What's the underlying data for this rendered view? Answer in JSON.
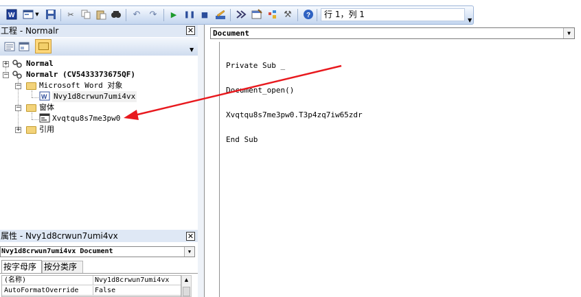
{
  "toolbar": {
    "position_text": "行 1，列 1"
  },
  "project_panel": {
    "title": "工程 - Normalr",
    "close_glyph": "✕",
    "tree": {
      "normal": "Normal",
      "normalr": "Normalr (CV5433373675QF)",
      "word_objects": "Microsoft Word 对象",
      "document": "Nvy1d8crwun7umi4vx",
      "forms": "窗体",
      "form_item": "Xvqtqu8s7me3pw0",
      "references": "引用"
    }
  },
  "properties_panel": {
    "title": "属性 - Nvy1d8crwun7umi4vx",
    "close_glyph": "✕",
    "object_select": "Nvy1d8crwun7umi4vx Document",
    "tabs": [
      "按字母序",
      "按分类序"
    ],
    "rows": [
      {
        "name": "(名称)",
        "value": "Nvy1d8crwun7umi4vx"
      },
      {
        "name": "AutoFormatOverride",
        "value": "False"
      }
    ]
  },
  "code_window": {
    "object_combo": "Document",
    "lines": [
      "Private Sub _",
      "Document_open()",
      "Xvqtqu8s7me3pw0.T3p4zq7iw65zdr",
      "End Sub"
    ]
  },
  "colors": {
    "arrow": "#e8191e",
    "panel_title_bg": "#dfe8f5",
    "toolbar_bg": "#c4d6ef"
  }
}
